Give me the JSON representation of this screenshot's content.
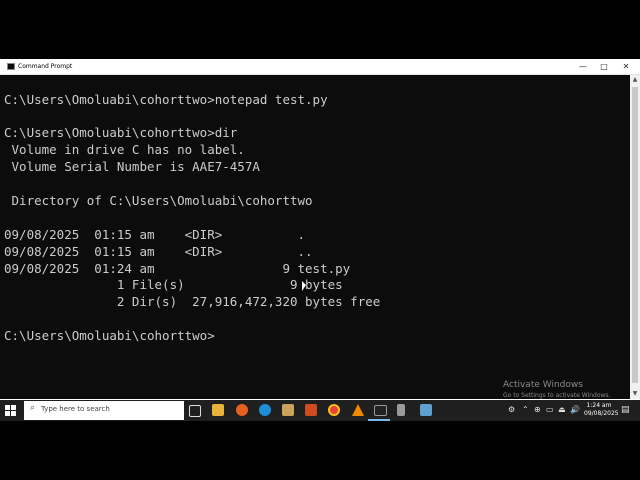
{
  "window": {
    "title": "Command Prompt",
    "minimize_glyph": "—",
    "maximize_glyph": "□",
    "close_glyph": "✕"
  },
  "console": {
    "lines": [
      "",
      "C:\\Users\\Omoluabi\\cohorttwo>notepad test.py",
      "",
      "C:\\Users\\Omoluabi\\cohorttwo>dir",
      " Volume in drive C has no label.",
      " Volume Serial Number is AAE7-457A",
      "",
      " Directory of C:\\Users\\Omoluabi\\cohorttwo",
      "",
      "09/08/2025  01:15 am    <DIR>          .",
      "09/08/2025  01:15 am    <DIR>          ..",
      "09/08/2025  01:24 am                 9 test.py",
      "               1 File(s)              9 bytes",
      "               2 Dir(s)  27,916,472,320 bytes free",
      "",
      "C:\\Users\\Omoluabi\\cohorttwo>"
    ]
  },
  "watermark": {
    "title": "Activate Windows",
    "subtitle": "Go to Settings to activate Windows."
  },
  "taskbar": {
    "search_placeholder": "Type here to search",
    "search_glyph": "⌕",
    "clock_time": "1:24 am",
    "clock_date": "09/08/2025",
    "tray_glyphs": [
      "⚙",
      "⌃",
      "⊕",
      "▭",
      "⏏",
      "🔊"
    ],
    "notification_glyph": "▤"
  },
  "colors": {
    "console_bg": "#0c0c0c",
    "console_fg": "#cccccc",
    "taskbar_bg": "#1f1f1f"
  }
}
